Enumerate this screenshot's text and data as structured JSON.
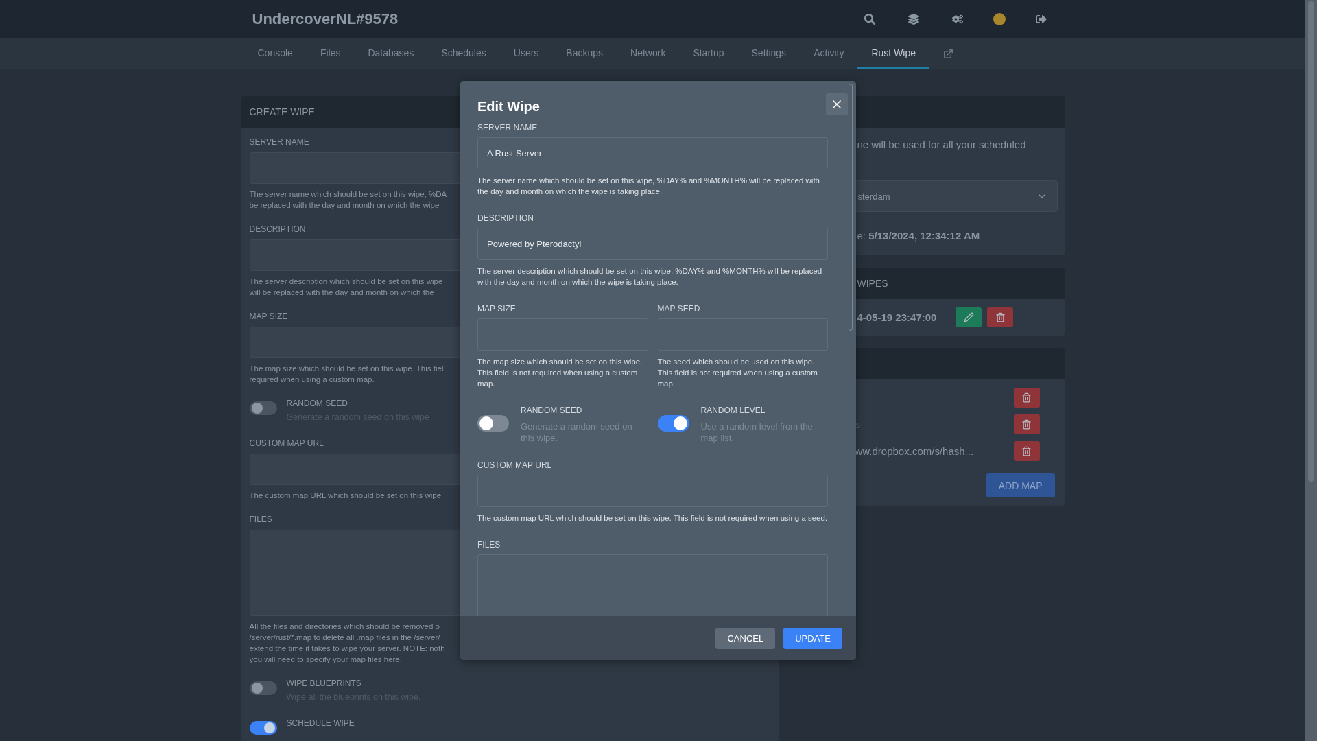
{
  "header": {
    "title": "UndercoverNL#9578"
  },
  "nav": [
    {
      "label": "Console",
      "selected": false
    },
    {
      "label": "Files",
      "selected": false
    },
    {
      "label": "Databases",
      "selected": false
    },
    {
      "label": "Schedules",
      "selected": false
    },
    {
      "label": "Users",
      "selected": false
    },
    {
      "label": "Backups",
      "selected": false
    },
    {
      "label": "Network",
      "selected": false
    },
    {
      "label": "Startup",
      "selected": false
    },
    {
      "label": "Settings",
      "selected": false
    },
    {
      "label": "Activity",
      "selected": false
    },
    {
      "label": "Rust Wipe",
      "selected": true
    }
  ],
  "create_wipe": {
    "title": "CREATE WIPE",
    "fields": [
      {
        "kind": "input",
        "label": "SERVER NAME",
        "help": [
          "The server name which should be set on this wipe, %DA",
          "be replaced with the day and month on which the wipe"
        ]
      },
      {
        "kind": "input",
        "label": "DESCRIPTION",
        "help": [
          "The server description which should be set on this wipe",
          "will be replaced with the day and month on which the"
        ]
      },
      {
        "kind": "input",
        "label": "MAP SIZE",
        "help": [
          "The map size which should be set on this wipe. This fiel",
          "required when using a custom map."
        ]
      },
      {
        "kind": "toggle",
        "label": "RANDOM SEED",
        "description": "Generate a random seed on this wipe",
        "on": false
      },
      {
        "kind": "input",
        "label": "CUSTOM MAP URL",
        "help": [
          "The custom map URL which should be set on this wipe."
        ]
      },
      {
        "kind": "textarea",
        "label": "FILES",
        "help": [
          "All the files and directories which should be removed o",
          "/server/rust/*.map to delete all .map files in the /server/",
          "extend the time it takes to wipe your server. NOTE: noth",
          "you will need to specify your map files here."
        ]
      },
      {
        "kind": "toggle",
        "label": "WIPE BLUEPRINTS",
        "description": "Wipe all the blueprints on this wipe.",
        "on": false
      },
      {
        "kind": "toggle",
        "label": "SCHEDULE WIPE",
        "on": true
      }
    ]
  },
  "timezone_card": {
    "text": "ne will be used for all your scheduled",
    "select": "sterdam",
    "time_label": "e:",
    "time_value": "5/13/2024, 12:34:12 AM"
  },
  "wipes_card": {
    "title": "WIPES",
    "rows": [
      {
        "time": "4-05-19 23:47:00"
      }
    ]
  },
  "maps_card": {
    "rows": [
      {
        "kind": "blank"
      },
      {
        "kind": "url",
        "url": "s"
      },
      {
        "kind": "url",
        "url": "ww.dropbox.com/s/hash..."
      }
    ],
    "add_button": "ADD MAP"
  },
  "modal": {
    "title": "Edit Wipe",
    "fields": [
      {
        "kind": "input",
        "label": "SERVER NAME",
        "value": "A Rust Server",
        "help": "The server name which should be set on this wipe, %DAY% and %MONTH% will be replaced with the day and month on which the wipe is taking place."
      },
      {
        "kind": "input",
        "label": "DESCRIPTION",
        "value": "Powered by Pterodactyl",
        "help": "The server description which should be set on this wipe, %DAY% and %MONTH% will be replaced with the day and month on which the wipe is taking place."
      },
      {
        "kind": "pair",
        "items": [
          {
            "label": "MAP SIZE",
            "help": "The map size which should be set on this wipe. This field is not required when using a custom map."
          },
          {
            "label": "MAP SEED",
            "help": "The seed which should be used on this wipe. This field is not required when using a custom map."
          }
        ]
      },
      {
        "kind": "toggles",
        "items": [
          {
            "label": "RANDOM SEED",
            "description": "Generate a random seed on this wipe.",
            "on": false
          },
          {
            "label": "RANDOM LEVEL",
            "description": "Use a random level from the map list.",
            "on": true
          }
        ]
      },
      {
        "kind": "input",
        "label": "CUSTOM MAP URL",
        "help": "The custom map URL which should be set on this wipe. This field is not required when using a seed."
      },
      {
        "kind": "textarea",
        "label": "FILES"
      }
    ],
    "buttons": [
      {
        "label": "CANCEL",
        "kind": "secondary"
      },
      {
        "label": "UPDATE",
        "kind": "primary"
      }
    ]
  }
}
